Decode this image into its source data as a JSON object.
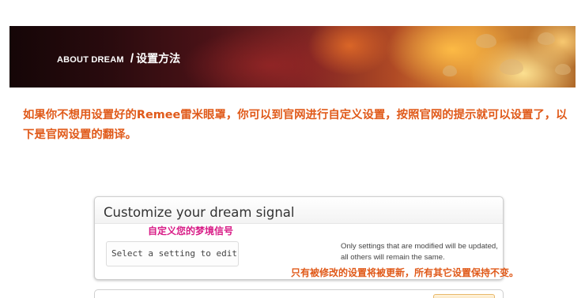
{
  "banner": {
    "title_en": "ABOUT DREAM",
    "separator": "/",
    "title_zh": "设置方法"
  },
  "intro": {
    "text": "如果你不想用设置好的Remee雷米眼罩，你可以到官网进行自定义设置，按照官网的提示就可以设置了，以下是官网设置的翻译。"
  },
  "card": {
    "title": "Customize your dream signal",
    "subtitle_zh": "自定义您的梦境信号",
    "select_placeholder": "Select a setting to edit",
    "hint": "Only settings that are modified will be updated, all others will remain the same.",
    "note_zh": "只有被修改的设置将被更新，所有其它设置保持不变。"
  },
  "colors": {
    "accent_orange": "#e05a1a",
    "subtitle_magenta": "#d81b86"
  }
}
